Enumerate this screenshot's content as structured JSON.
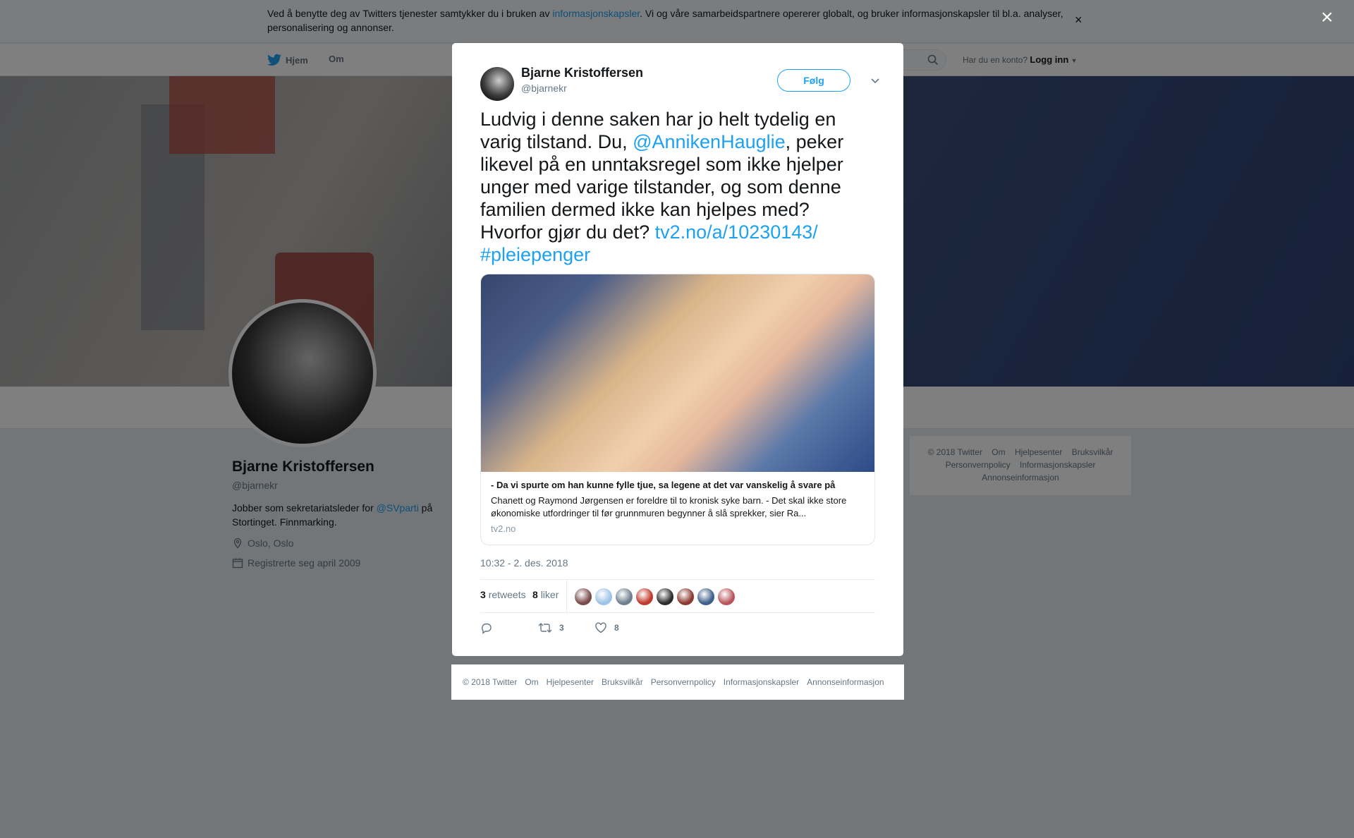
{
  "cookie_bar": {
    "text_before": "Ved å benytte deg av Twitters tjenester samtykker du i bruken av ",
    "link": "informasjonskapsler",
    "text_after": ". Vi og våre samarbeidspartnere opererer globalt, og bruker informasjonskapsler til bl.a. analyser, personalisering og annonser.",
    "close": "×"
  },
  "nav": {
    "home": "Hjem",
    "about": "Om",
    "account_prompt": "Har du en konto?",
    "login": "Logg inn"
  },
  "profile": {
    "name": "Bjarne Kristoffersen",
    "handle": "@bjarnekr",
    "bio_before": "Jobber som sekretariatsleder for ",
    "bio_link": "@SVparti",
    "bio_after": " på Stortinget. Finnmarking.",
    "location": "Oslo, Oslo",
    "joined": "Registrerte seg april 2009"
  },
  "side_footer": {
    "items": [
      "© 2018 Twitter",
      "Om",
      "Hjelpesenter",
      "Bruksvilkår",
      "Personvernpolicy",
      "Informasjonskapsler",
      "Annonseinformasjon"
    ]
  },
  "overlay": {
    "close": "×"
  },
  "tweet": {
    "author_name": "Bjarne Kristoffersen",
    "author_handle": "@bjarnekr",
    "follow_label": "Følg",
    "text_1": "Ludvig i denne saken har jo helt tydelig en varig tilstand. Du, ",
    "mention": "@AnnikenHauglie",
    "text_2": ", peker likevel på en unntaksregel som ikke hjelper unger med varige tilstander, og som denne familien dermed ikke kan hjelpes med? Hvorfor gjør du det? ",
    "link": "tv2.no/a/10230143/",
    "hashtag": "#pleiepenger",
    "card": {
      "headline": "- Da vi spurte om han kunne fylle tjue, sa legene at det var vanskelig å svare på",
      "description": "Chanett og Raymond Jørgensen er foreldre til to kronisk syke barn. - Det skal ikke store økonomiske utfordringer til før grunnmuren begynner å slå sprekker, sier Ra...",
      "domain": "tv2.no"
    },
    "timestamp": "10:32 - 2. des. 2018",
    "retweets_count": "3",
    "retweets_label": "retweets",
    "likes_count": "8",
    "likes_label": "liker",
    "liker_colors": [
      "#7a4b4b",
      "#9fc3e6",
      "#6f7f8f",
      "#c0392b",
      "#2b2b2b",
      "#8b3a2f",
      "#3e5f8a",
      "#b8555c"
    ],
    "action_retweets": "3",
    "action_likes": "8"
  },
  "modal_footer": {
    "items": [
      "© 2018 Twitter",
      "Om",
      "Hjelpesenter",
      "Bruksvilkår",
      "Personvernpolicy",
      "Informasjonskapsler",
      "Annonseinformasjon"
    ]
  }
}
